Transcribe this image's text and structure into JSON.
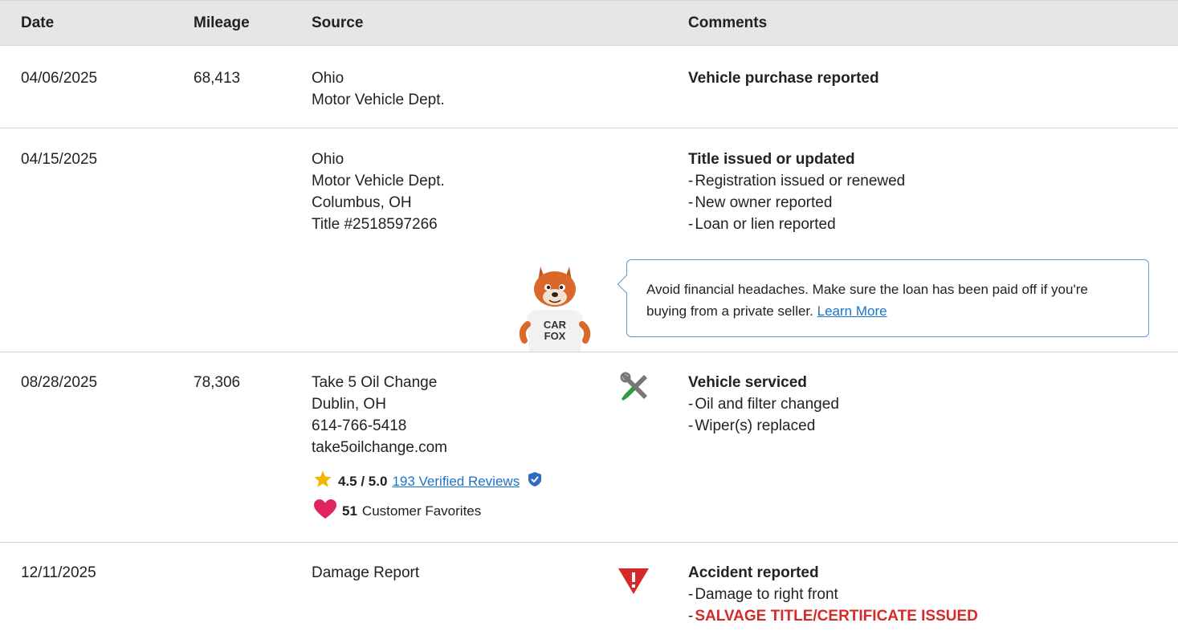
{
  "header": {
    "date": "Date",
    "mileage": "Mileage",
    "source": "Source",
    "comments": "Comments"
  },
  "rows": [
    {
      "date": "04/06/2025",
      "mileage": "68,413",
      "source": [
        "Ohio",
        "Motor Vehicle Dept."
      ],
      "title": "Vehicle purchase reported",
      "bullets": []
    },
    {
      "date": "04/15/2025",
      "mileage": "",
      "source": [
        "Ohio",
        "Motor Vehicle Dept.",
        "Columbus, OH",
        "Title #2518597266"
      ],
      "title": "Title issued or updated",
      "bullets": [
        "Registration issued or renewed",
        "New owner reported",
        "Loan or lien reported"
      ],
      "callout": {
        "text": "Avoid financial headaches. Make sure the loan has been paid off if you're buying from a private seller.",
        "link": "Learn More",
        "mascot_shirt_line1": "CAR",
        "mascot_shirt_line2": "FOX"
      }
    },
    {
      "date": "08/28/2025",
      "mileage": "78,306",
      "source": [
        "Take 5 Oil Change",
        "Dublin, OH",
        "614-766-5418",
        "take5oilchange.com"
      ],
      "rating": "4.5 / 5.0",
      "reviews_link": "193 Verified Reviews",
      "favorites_count": "51",
      "favorites_label": "Customer Favorites",
      "icon": "wrench-screwdriver-icon",
      "title": "Vehicle serviced",
      "bullets": [
        "Oil and filter changed",
        "Wiper(s) replaced"
      ]
    },
    {
      "date": "12/11/2025",
      "mileage": "",
      "source": [
        "Damage Report"
      ],
      "icon": "alert-triangle-icon",
      "title": "Accident reported",
      "bullets": [
        "Damage to right front"
      ],
      "alert_bullet": "SALVAGE TITLE/CERTIFICATE ISSUED"
    }
  ],
  "colors": {
    "header_bg": "#e6e6e6",
    "link": "#1a73c9",
    "alert_red": "#d62a2a",
    "callout_border": "#5b9bd5",
    "star": "#f5b400",
    "heart": "#e0245e"
  }
}
